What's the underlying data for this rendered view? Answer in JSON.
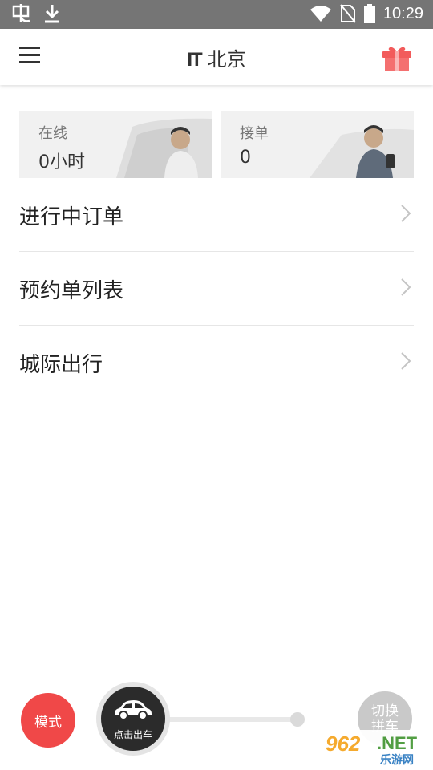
{
  "status_bar": {
    "time": "10:29",
    "left_icons": [
      "app-notification-icon",
      "download-icon"
    ],
    "right_icons": [
      "wifi-icon",
      "no-sim-icon",
      "battery-icon"
    ]
  },
  "header": {
    "logo_text": "IT",
    "city": "北京",
    "menu_icon": "hamburger-icon",
    "gift_icon": "gift-icon",
    "gift_color": "#f25b5b"
  },
  "stats": [
    {
      "label": "在线",
      "value": "0小时"
    },
    {
      "label": "接单",
      "value": "0"
    }
  ],
  "menu_items": [
    {
      "label": "进行中订单"
    },
    {
      "label": "预约单列表"
    },
    {
      "label": "城际出行"
    }
  ],
  "bottom_bar": {
    "mode_label": "模式",
    "mode_color": "#f04848",
    "go_label": "点击出车",
    "switch_line1": "切换",
    "switch_line2": "拼车"
  },
  "watermark": {
    "number": "962",
    "domain": ".NET",
    "text": "乐游网"
  }
}
